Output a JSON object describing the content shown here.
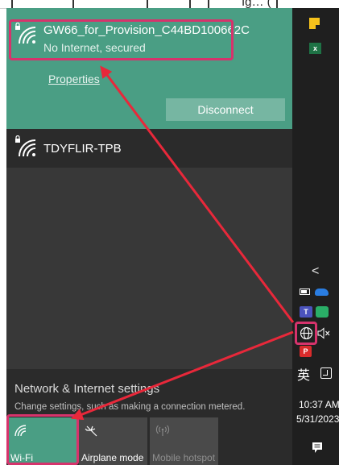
{
  "top_fragment": "Ig… (",
  "flyout": {
    "connected_network": {
      "name": "GW66_for_Provision_C44BD100662C",
      "status": "No Internet, secured",
      "properties_label": "Properties",
      "disconnect_label": "Disconnect",
      "icon": "wifi-secured-icon"
    },
    "other_networks": [
      {
        "name": "TDYFLIR-TPB",
        "icon": "wifi-secured-icon"
      }
    ],
    "settings": {
      "title": "Network & Internet settings",
      "description": "Change settings, such as making a connection metered."
    },
    "quick_actions": [
      {
        "label": "Wi-Fi",
        "icon": "wifi-icon",
        "state": "on"
      },
      {
        "label": "Airplane mode",
        "icon": "airplane-icon",
        "state": "off"
      },
      {
        "label": "Mobile hotspot",
        "icon": "hotspot-icon",
        "state": "disabled"
      }
    ]
  },
  "taskbar": {
    "pinned_icons": [
      "sticky-notes-icon",
      "excel-icon"
    ],
    "tray": {
      "chevron": "<",
      "ime_label": "英",
      "time": "10:37 AM",
      "date": "5/31/2023"
    }
  },
  "colors": {
    "accent": "#4a9e84",
    "annotation": "#d6336c",
    "arrow": "#e8283a"
  }
}
